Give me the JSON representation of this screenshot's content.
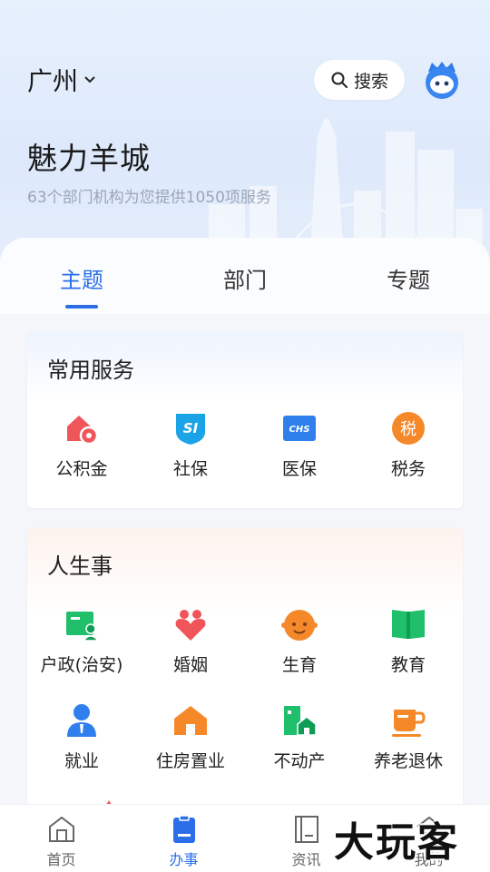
{
  "header": {
    "city": "广州",
    "search_label": "搜索",
    "title": "魅力羊城",
    "subtitle": "63个部门机构为您提供1050项服务"
  },
  "tabs": [
    {
      "label": "主题",
      "active": true
    },
    {
      "label": "部门",
      "active": false
    },
    {
      "label": "专题",
      "active": false
    }
  ],
  "common_services": {
    "title": "常用服务",
    "items": [
      {
        "label": "公积金",
        "icon": "housing-fund-icon"
      },
      {
        "label": "社保",
        "icon": "social-security-icon"
      },
      {
        "label": "医保",
        "icon": "medical-insurance-icon"
      },
      {
        "label": "税务",
        "icon": "tax-icon"
      }
    ]
  },
  "life_events": {
    "title": "人生事",
    "rows": [
      [
        {
          "label": "户政(治安)",
          "icon": "household-registration-icon"
        },
        {
          "label": "婚姻",
          "icon": "marriage-icon"
        },
        {
          "label": "生育",
          "icon": "childbirth-icon"
        },
        {
          "label": "教育",
          "icon": "education-icon"
        }
      ],
      [
        {
          "label": "就业",
          "icon": "employment-icon"
        },
        {
          "label": "住房置业",
          "icon": "housing-icon"
        },
        {
          "label": "不动产",
          "icon": "real-estate-icon"
        },
        {
          "label": "养老退休",
          "icon": "retirement-icon"
        }
      ]
    ]
  },
  "tabbar": [
    {
      "label": "首页",
      "icon": "home-icon",
      "active": false
    },
    {
      "label": "办事",
      "icon": "services-icon",
      "active": true
    },
    {
      "label": "资讯",
      "icon": "news-icon",
      "active": false
    },
    {
      "label": "我的",
      "icon": "profile-icon",
      "active": false
    }
  ],
  "watermark": "大玩客",
  "colors": {
    "accent": "#2b6ee8",
    "housing_fund": "#f0555a",
    "social_security": "#1aa3e6",
    "medical": "#2f80ed",
    "tax": "#f5892a",
    "green": "#1fbf6b",
    "orange": "#f5892a"
  }
}
